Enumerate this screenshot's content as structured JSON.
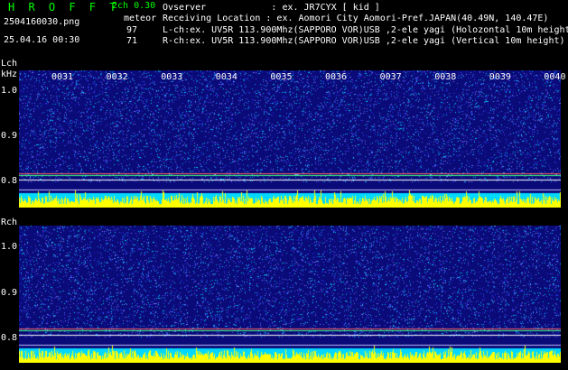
{
  "header": {
    "app_title": "H R O F F T",
    "mode": "2ch 0.30",
    "meteor_label": "meteor",
    "filename": "2504160030.png",
    "datetime": "25.04.16 00:30",
    "count_l": "97",
    "count_r": "71",
    "observer": "Ovserver            : ex. JR7CYX [ kid ]",
    "location": "Receiving Location : ex. Aomori City Aomori-Pref.JAPAN(40.49N, 140.47E)",
    "lch_info": "L-ch:ex. UV5R 113.900Mhz(SAPPORO VOR)USB ,2-ele yagi (Holozontal 10m height)",
    "rch_info": "R-ch:ex. UV5R 113.900Mhz(SAPPORO VOR)USB ,2-ele yagi (Vertical 10m height)"
  },
  "lch_panel": {
    "label": "Lch",
    "unit": "kHz",
    "y_ticks": [
      "1.0",
      "0.9",
      "0.8"
    ],
    "time_ticks": [
      "0031",
      "0032",
      "0033",
      "0034",
      "0035",
      "0036",
      "0037",
      "0038",
      "0039",
      "0040"
    ]
  },
  "rch_panel": {
    "label": "Rch",
    "y_ticks": [
      "1.0",
      "0.9",
      "0.8"
    ]
  },
  "colors": {
    "background": "#000000",
    "waterfall_bg": "#0a0a7a",
    "title_green": "#00ff00",
    "level_yellow": "#ffff00",
    "level_cyan": "#00e0ff"
  }
}
